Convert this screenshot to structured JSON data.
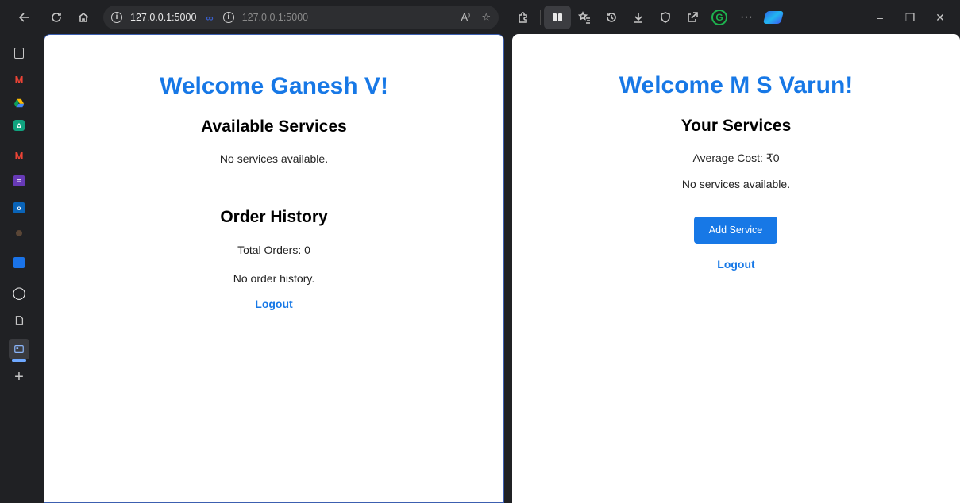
{
  "browser": {
    "url_primary": "127.0.0.1:5000",
    "url_secondary": "127.0.0.1:5000",
    "icons": {
      "back": "arrow-left-icon",
      "refresh": "refresh-icon",
      "home": "home-icon",
      "read_aloud": "A⁾",
      "favorite": "☆"
    }
  },
  "left_pane": {
    "welcome": "Welcome Ganesh V!",
    "services_heading": "Available Services",
    "services_empty": "No services available.",
    "orders_heading": "Order History",
    "total_orders": "Total Orders: 0",
    "orders_empty": "No order history.",
    "logout": "Logout"
  },
  "right_pane": {
    "welcome": "Welcome M S Varun!",
    "services_heading": "Your Services",
    "average_cost": "Average Cost: ₹0",
    "services_empty": "No services available.",
    "add_service": "Add Service",
    "logout": "Logout"
  },
  "colors": {
    "accent": "#1778e6",
    "chrome_bg": "#202124"
  }
}
